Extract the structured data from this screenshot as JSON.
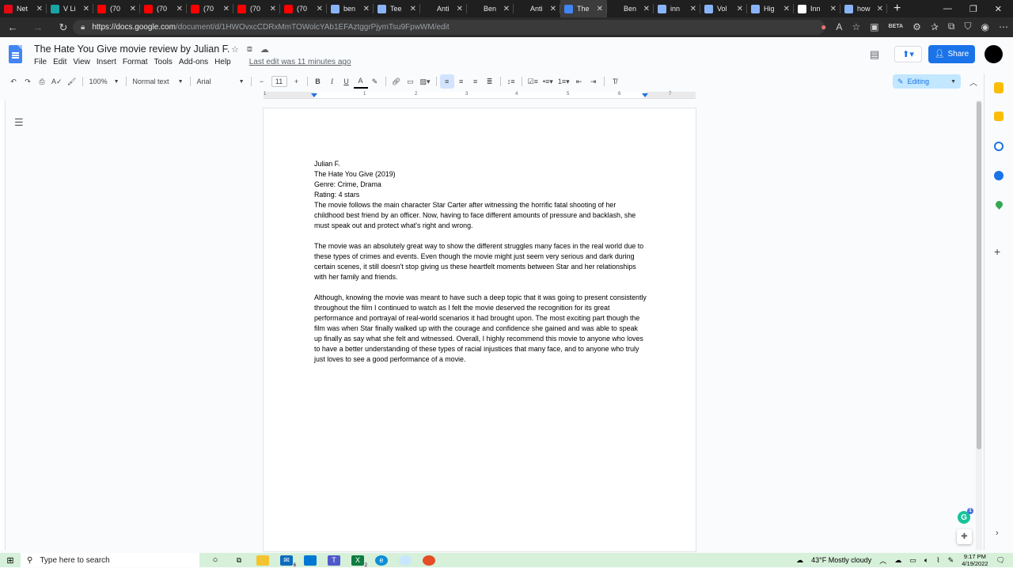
{
  "browser": {
    "tabs": [
      {
        "label": "Net",
        "color": "#e50914"
      },
      {
        "label": "V Li",
        "color": "#1aa3a3"
      },
      {
        "label": "(70",
        "color": "#ff0000"
      },
      {
        "label": "(70",
        "color": "#ff0000"
      },
      {
        "label": "(70",
        "color": "#ff0000"
      },
      {
        "label": "(70",
        "color": "#ff0000"
      },
      {
        "label": "(70",
        "color": "#ff0000"
      },
      {
        "label": "ben",
        "color": "#8ab4f8"
      },
      {
        "label": "Tee",
        "color": "#8ab4f8"
      },
      {
        "label": "Anti",
        "color": "#1f1f1f"
      },
      {
        "label": "Ben",
        "color": "#1f1f1f"
      },
      {
        "label": "Anti",
        "color": "#1f1f1f"
      },
      {
        "label": "The",
        "color": "#4285f4"
      },
      {
        "label": "Ben",
        "color": "#1f1f1f"
      },
      {
        "label": "inn",
        "color": "#8ab4f8"
      },
      {
        "label": "Vol",
        "color": "#8ab4f8"
      },
      {
        "label": "Hig",
        "color": "#8ab4f8"
      },
      {
        "label": "Inn",
        "color": "#ffffff"
      },
      {
        "label": "how",
        "color": "#8ab4f8"
      }
    ],
    "close_glyph": "✕",
    "new_tab_glyph": "+",
    "url_host": "https://docs.google.com",
    "url_path": "/document/d/1HWOvxcCDRxMmTOWolcYAb1EFAztggrPjymTsu9FpwWM/edit",
    "extension_badge": "BETA"
  },
  "docs": {
    "title": "The Hate You Give movie review by Julian F.",
    "menu": [
      "File",
      "Edit",
      "View",
      "Insert",
      "Format",
      "Tools",
      "Add-ons",
      "Help"
    ],
    "last_edit": "Last edit was 11 minutes ago",
    "share_label": "Share",
    "toolbar": {
      "zoom": "100%",
      "style": "Normal text",
      "font": "Arial",
      "font_size": "11",
      "mode": "Editing"
    },
    "ruler_numbers": [
      "1",
      "1",
      "2",
      "3",
      "4",
      "5",
      "6",
      "7"
    ],
    "body": {
      "author": "Julian F.",
      "movie": "The Hate You Give (2019)",
      "genre": "Genre: Crime, Drama",
      "rating": "Rating: 4 stars",
      "p1": "The movie follows the main character Star Carter after witnessing the horrific fatal shooting of her childhood best friend by an officer. Now, having to face different amounts of pressure and backlash, she must speak out and protect what's right and wrong.",
      "p2": "The movie was an absolutely great way to show the different struggles many faces in the real world due to these types of crimes and events. Even though the movie might just seem very serious and dark during certain scenes, it still doesn't stop giving us these heartfelt moments between Star and her relationships with her family and friends.",
      "p3": "Although, knowing the movie was meant to have such a deep topic that it was going to present consistently throughout the film I continued to watch as I felt the movie deserved the recognition for its great performance and portrayal of real-world scenarios it had brought upon. The most exciting part though the film was when Star finally walked up with the courage and confidence she gained and was able to speak up finally as say what she felt and witnessed. Overall, I highly recommend this movie to anyone who loves to have a better understanding of these types of racial injustices that many face, and to anyone who truly just loves to see a good performance of a movie."
    },
    "grammarly_badge": "1"
  },
  "taskbar": {
    "search_placeholder": "Type here to search",
    "mail_count": "6",
    "excel_count": "2",
    "weather": "43°F  Mostly cloudy",
    "time": "9:17 PM",
    "date": "4/19/2022"
  }
}
